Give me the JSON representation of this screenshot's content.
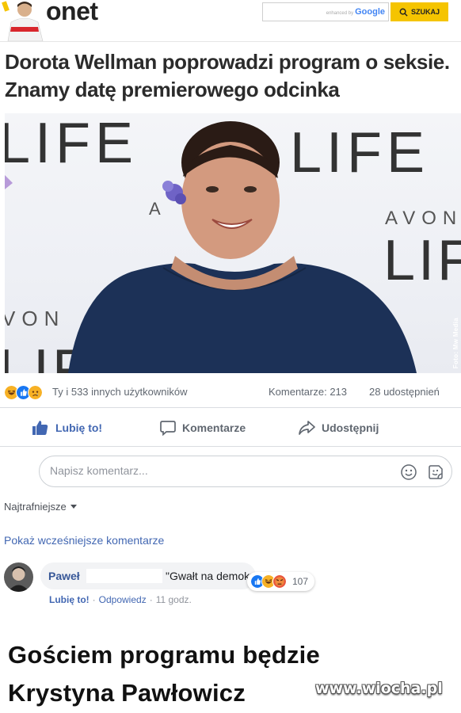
{
  "header": {
    "logo": "onet",
    "search_enhanced": "enhanced by",
    "search_google": "Google",
    "search_button_label": "SZUKAJ"
  },
  "article": {
    "headline": "Dorota Wellman poprowadzi program o seksie. Znamy datę premierowego odcinka",
    "photo_credit": "Foto: Mw Media",
    "photo_backdrop_text": [
      "LIFE",
      "AVON",
      "LIFE",
      "LIF",
      "VON",
      "LIF",
      "A"
    ]
  },
  "engagement": {
    "reactions_text": "Ty i 533 innych użytkowników",
    "comments_text": "Komentarze: 213",
    "shares_text": "28 udostępnień"
  },
  "actions": {
    "like": "Lubię to!",
    "comment": "Komentarze",
    "share": "Udostępnij"
  },
  "composer": {
    "placeholder": "Napisz komentarz..."
  },
  "comments_section": {
    "sort_label": "Najtrafniejsze",
    "show_previous": "Pokaż wcześniejsze komentarze"
  },
  "comment": {
    "author": "Paweł",
    "text": "\"Gwałt na demokracji\"",
    "reaction_count": "107",
    "like_label": "Lubię to!",
    "reply_label": "Odpowiedz",
    "separator": "·",
    "time": "11 godz."
  },
  "meme": {
    "caption_line1": "Gościem programu będzie",
    "caption_line2": "Krystyna Pawłowicz",
    "watermark": "www.wiocha.pl"
  },
  "colors": {
    "fb_blue": "#4267b2",
    "link_blue": "#385898",
    "search_yellow": "#f5c400",
    "dress_navy": "#1c3157"
  }
}
